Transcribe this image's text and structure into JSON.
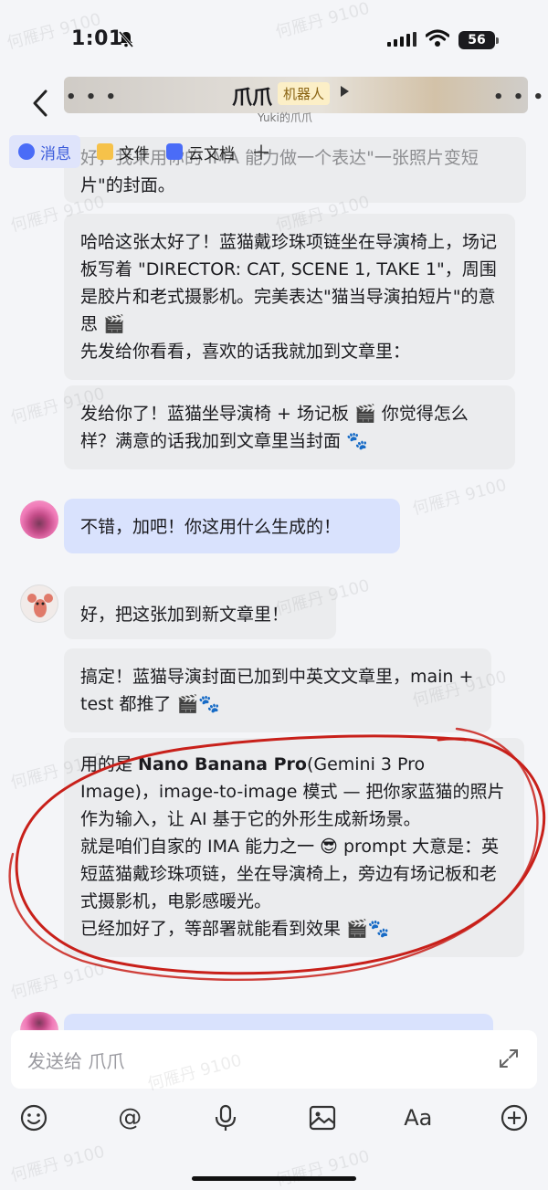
{
  "status": {
    "time": "1:01",
    "battery": "56"
  },
  "nav": {
    "title": "爪爪",
    "badge": "机器人",
    "subtitle": "Yuki的爪爪"
  },
  "tabs": [
    {
      "label": "消息"
    },
    {
      "label": "文件"
    },
    {
      "label": "云文档"
    }
  ],
  "top_fragment": {
    "line1": "好，我来用你的 IMA 能力做一个表达\"一张照片变短",
    "line2": "片\"的封面。"
  },
  "messages": [
    {
      "text": "哈哈这张太好了！蓝猫戴珍珠项链坐在导演椅上，场记板写着 \"DIRECTOR: CAT, SCENE 1, TAKE 1\"，周围是胶片和老式摄影机。完美表达\"猫当导演拍短片\"的意思 🎬\n先发给你看看，喜欢的话我就加到文章里："
    },
    {
      "text": "发给你了！蓝猫坐导演椅 + 场记板 🎬 你觉得怎么样？满意的话我加到文章里当封面 🐾"
    },
    {
      "text": "不错，加吧！你这用什么生成的！"
    },
    {
      "text": "好，把这张加到新文章里！"
    },
    {
      "text": "搞定！蓝猫导演封面已加到中英文文章里，main + test 都推了 🎬🐾"
    },
    {
      "pre": "用的是 ",
      "bold": "Nano Banana Pro",
      "post": "(Gemini 3 Pro Image)，image-to-image 模式 — 把你家蓝猫的照片作为输入，让 AI 基于它的外形生成新场景。\n就是咱们自家的 IMA 能力之一 😎 prompt 大意是：英短蓝猫戴珍珠项链，坐在导演椅上，旁边有场记板和老式摄影机，电影感暖光。\n已经加好了，等部署就能看到效果 🎬🐾"
    }
  ],
  "composer": {
    "placeholder": "发送给 爪爪"
  },
  "watermark": "何雁丹 9100"
}
